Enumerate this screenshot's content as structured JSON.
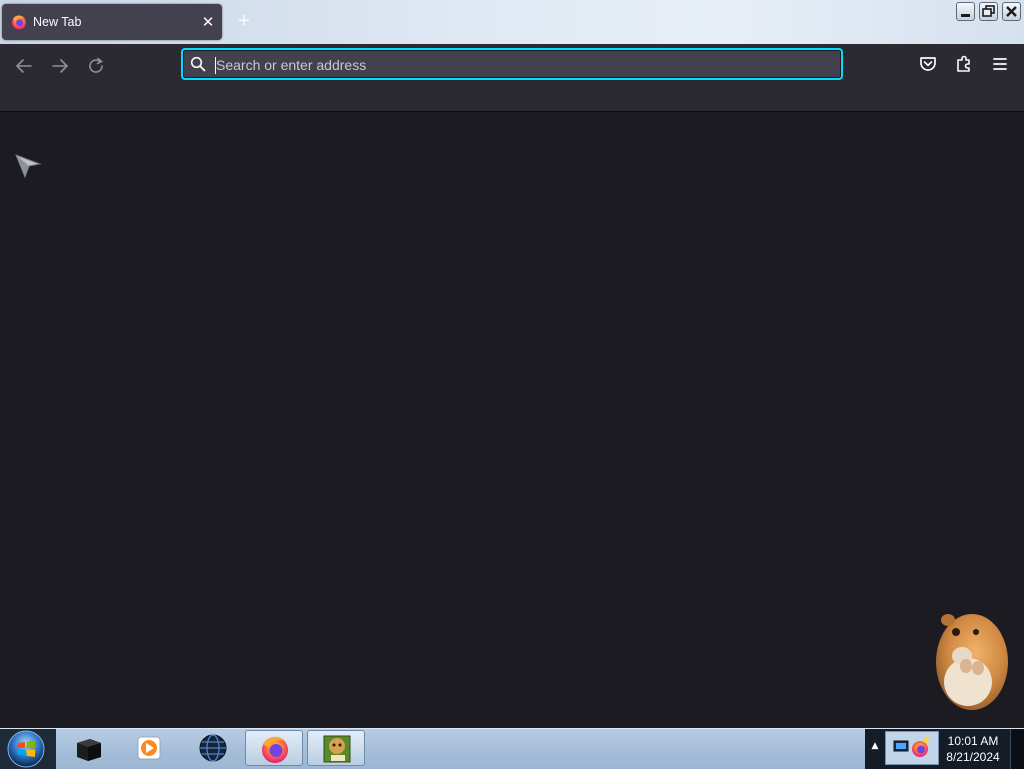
{
  "browser": {
    "tab": {
      "title": "New Tab",
      "close_glyph": "✕"
    },
    "new_tab_glyph": "+",
    "urlbar": {
      "placeholder": "Search or enter address",
      "value": ""
    },
    "accent_color": "#00ddff",
    "toolbar_color": "#2b2a33",
    "content_color": "#1c1b22"
  },
  "icons": {
    "tab_favicon": "firefox-icon",
    "back": "back-arrow-icon",
    "forward": "forward-arrow-icon",
    "reload": "reload-icon",
    "search": "search-icon",
    "pocket": "pocket-icon",
    "extensions": "puzzle-piece-icon",
    "menu": "hamburger-menu-icon",
    "pointer": "mouse-pointer-icon",
    "pet": "hamster-desktop-pet"
  },
  "taskbar": {
    "items": [
      {
        "name": "black-box-app-icon",
        "active": false
      },
      {
        "name": "media-player-icon",
        "active": false
      },
      {
        "name": "globe-app-icon",
        "active": false
      },
      {
        "name": "firefox-icon",
        "active": true
      },
      {
        "name": "game-box-icon",
        "active": true
      }
    ],
    "tray_expand_glyph": "▲",
    "clock": {
      "time": "10:01 AM",
      "date": "8/21/2024"
    }
  }
}
